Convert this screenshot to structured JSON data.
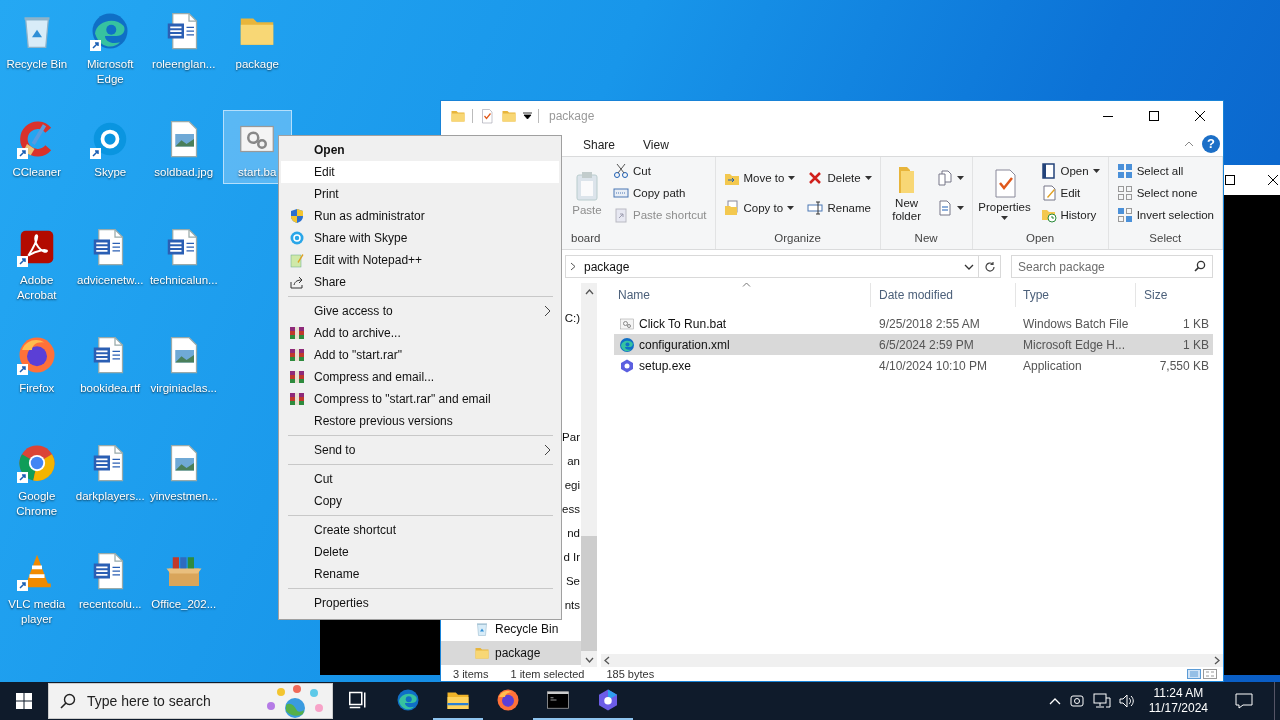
{
  "desktop_icons": [
    {
      "label": "Recycle Bin",
      "kind": "recycle",
      "shortcut": false,
      "selected": false
    },
    {
      "label": "CCleaner",
      "kind": "ccleaner",
      "shortcut": true,
      "selected": false
    },
    {
      "label": "Adobe Acrobat",
      "kind": "acrobat",
      "shortcut": true,
      "selected": false
    },
    {
      "label": "Firefox",
      "kind": "firefox",
      "shortcut": true,
      "selected": false
    },
    {
      "label": "Google Chrome",
      "kind": "chrome",
      "shortcut": true,
      "selected": false
    },
    {
      "label": "VLC media player",
      "kind": "vlc",
      "shortcut": true,
      "selected": false
    },
    {
      "label": "Microsoft Edge",
      "kind": "edge",
      "shortcut": true,
      "selected": false
    },
    {
      "label": "Skype",
      "kind": "skype",
      "shortcut": true,
      "selected": false
    },
    {
      "label": "advicenetw...",
      "kind": "word",
      "shortcut": false,
      "selected": false
    },
    {
      "label": "bookidea.rtf",
      "kind": "word",
      "shortcut": false,
      "selected": false
    },
    {
      "label": "darkplayers...",
      "kind": "word",
      "shortcut": false,
      "selected": false
    },
    {
      "label": "recentcolu...",
      "kind": "word",
      "shortcut": false,
      "selected": false
    },
    {
      "label": "roleenglan...",
      "kind": "word",
      "shortcut": false,
      "selected": false
    },
    {
      "label": "soldbad.jpg",
      "kind": "image",
      "shortcut": false,
      "selected": false
    },
    {
      "label": "technicalun...",
      "kind": "word",
      "shortcut": false,
      "selected": false
    },
    {
      "label": "virginiaclas...",
      "kind": "image",
      "shortcut": false,
      "selected": false
    },
    {
      "label": "yinvestmen...",
      "kind": "image",
      "shortcut": false,
      "selected": false
    },
    {
      "label": "Office_202...",
      "kind": "archive",
      "shortcut": false,
      "selected": false
    },
    {
      "label": "package",
      "kind": "folder",
      "shortcut": false,
      "selected": false
    },
    {
      "label": "start.ba",
      "kind": "bat",
      "shortcut": false,
      "selected": true
    }
  ],
  "explorer": {
    "title": "package",
    "ribbon_tabs": [
      {
        "label": "Share",
        "selected": false
      },
      {
        "label": "View",
        "selected": false
      }
    ],
    "help_label": "?",
    "ribbon_groups": [
      {
        "label": "board",
        "columns": [
          {
            "kind": "large",
            "buttons": [
              {
                "label": "Paste",
                "kind": "paste",
                "dropdown": false,
                "disabled": true
              }
            ]
          },
          {
            "kind": "small",
            "buttons": [
              {
                "label": "Cut",
                "kind": "cut",
                "dropdown": false,
                "disabled": false
              },
              {
                "label": "Copy path",
                "kind": "copypath",
                "dropdown": false,
                "disabled": false
              },
              {
                "label": "Paste shortcut",
                "kind": "pasteshortcut",
                "dropdown": false,
                "disabled": true
              }
            ]
          }
        ]
      },
      {
        "label": "Organize",
        "columns": [
          {
            "kind": "small",
            "buttons": [
              {
                "label": "Move to",
                "kind": "move",
                "dropdown": true,
                "disabled": false
              },
              {
                "label": "Copy to",
                "kind": "copy",
                "dropdown": true,
                "disabled": false
              }
            ]
          },
          {
            "kind": "small",
            "buttons": [
              {
                "label": "Delete",
                "kind": "delete",
                "dropdown": true,
                "disabled": false
              },
              {
                "label": "Rename",
                "kind": "rename",
                "dropdown": false,
                "disabled": false
              }
            ]
          }
        ]
      },
      {
        "label": "New",
        "columns": [
          {
            "kind": "large",
            "buttons": [
              {
                "label": "New folder",
                "kind": "newfolder",
                "dropdown": false,
                "disabled": false
              }
            ]
          },
          {
            "kind": "small",
            "buttons": [
              {
                "kind": "newitem",
                "dropdown": true,
                "disabled": false
              },
              {
                "kind": "easyaccess",
                "dropdown": true,
                "disabled": false
              }
            ]
          }
        ]
      },
      {
        "label": "Open",
        "columns": [
          {
            "kind": "large",
            "buttons": [
              {
                "label": "Properties",
                "kind": "properties",
                "dropdown": true,
                "disabled": false
              }
            ]
          },
          {
            "kind": "small",
            "buttons": [
              {
                "label": "Open",
                "kind": "open",
                "dropdown": true,
                "disabled": false
              },
              {
                "label": "Edit",
                "kind": "edit",
                "dropdown": false,
                "disabled": false
              },
              {
                "label": "History",
                "kind": "history",
                "dropdown": false,
                "disabled": false
              }
            ]
          }
        ]
      },
      {
        "label": "Select",
        "columns": [
          {
            "kind": "small",
            "buttons": [
              {
                "label": "Select all",
                "kind": "selectall",
                "dropdown": false,
                "disabled": false
              },
              {
                "label": "Select none",
                "kind": "selectnone",
                "dropdown": false,
                "disabled": false
              },
              {
                "label": "Invert selection",
                "kind": "invert",
                "dropdown": false,
                "disabled": false
              }
            ]
          }
        ]
      }
    ],
    "address": "package",
    "search_placeholder": "Search package",
    "nav_items": [
      {
        "label": "C:)",
        "kind": "fragment",
        "selected": false
      },
      {
        "label": "Par",
        "kind": "fragment",
        "selected": false
      },
      {
        "label": "an",
        "kind": "fragment",
        "selected": false
      },
      {
        "label": "egi",
        "kind": "fragment",
        "selected": false
      },
      {
        "label": "ess",
        "kind": "fragment",
        "selected": false
      },
      {
        "label": "nd",
        "kind": "fragment",
        "selected": false
      },
      {
        "label": "d Ir",
        "kind": "fragment",
        "selected": false
      },
      {
        "label": "Se",
        "kind": "fragment",
        "selected": false
      },
      {
        "label": "nts",
        "kind": "fragment",
        "selected": false
      },
      {
        "label": "Recycle Bin",
        "kind": "recycle",
        "selected": false
      },
      {
        "label": "package",
        "kind": "folder",
        "selected": true
      }
    ],
    "columns": [
      {
        "label": "Name",
        "sorted": true
      },
      {
        "label": "Date modified",
        "sorted": false
      },
      {
        "label": "Type",
        "sorted": false
      },
      {
        "label": "Size",
        "sorted": false
      }
    ],
    "rows": [
      {
        "kind": "bat",
        "name": "Click To Run.bat",
        "date": "9/25/2018 2:55 AM",
        "type": "Windows Batch File",
        "size": "1 KB",
        "selected": false
      },
      {
        "kind": "edge",
        "name": "configuration.xml",
        "date": "6/5/2024 2:59 PM",
        "type": "Microsoft Edge H...",
        "size": "1 KB",
        "selected": true
      },
      {
        "kind": "setup",
        "name": "setup.exe",
        "date": "4/10/2024 10:10 PM",
        "type": "Application",
        "size": "7,550 KB",
        "selected": false
      }
    ],
    "status": [
      "3 items",
      "1 item selected",
      "185 bytes"
    ]
  },
  "context_menu": {
    "items": [
      {
        "kind": "plain",
        "label": "Open",
        "bold": true,
        "selected": false,
        "submenu": false
      },
      {
        "kind": "plain",
        "label": "Edit",
        "bold": false,
        "selected": true,
        "submenu": false
      },
      {
        "kind": "plain",
        "label": "Print",
        "bold": false,
        "selected": false,
        "submenu": false
      },
      {
        "kind": "shield",
        "label": "Run as administrator",
        "bold": false,
        "selected": false,
        "submenu": false
      },
      {
        "kind": "skype",
        "label": "Share with Skype",
        "bold": false,
        "selected": false,
        "submenu": false
      },
      {
        "kind": "notepad",
        "label": "Edit with Notepad++",
        "bold": false,
        "selected": false,
        "submenu": false
      },
      {
        "kind": "share",
        "label": "Share",
        "bold": false,
        "selected": false,
        "submenu": false
      },
      {
        "kind": "separator"
      },
      {
        "kind": "plain",
        "label": "Give access to",
        "bold": false,
        "selected": false,
        "submenu": true
      },
      {
        "kind": "winrar",
        "label": "Add to archive...",
        "bold": false,
        "selected": false,
        "submenu": false
      },
      {
        "kind": "winrar",
        "label": "Add to \"start.rar\"",
        "bold": false,
        "selected": false,
        "submenu": false
      },
      {
        "kind": "winrar",
        "label": "Compress and email...",
        "bold": false,
        "selected": false,
        "submenu": false
      },
      {
        "kind": "winrar",
        "label": "Compress to \"start.rar\" and email",
        "bold": false,
        "selected": false,
        "submenu": false
      },
      {
        "kind": "plain",
        "label": "Restore previous versions",
        "bold": false,
        "selected": false,
        "submenu": false
      },
      {
        "kind": "separator"
      },
      {
        "kind": "plain",
        "label": "Send to",
        "bold": false,
        "selected": false,
        "submenu": true
      },
      {
        "kind": "separator"
      },
      {
        "kind": "plain",
        "label": "Cut",
        "bold": false,
        "selected": false,
        "submenu": false
      },
      {
        "kind": "plain",
        "label": "Copy",
        "bold": false,
        "selected": false,
        "submenu": false
      },
      {
        "kind": "separator"
      },
      {
        "kind": "plain",
        "label": "Create shortcut",
        "bold": false,
        "selected": false,
        "submenu": false
      },
      {
        "kind": "plain",
        "label": "Delete",
        "bold": false,
        "selected": false,
        "submenu": false
      },
      {
        "kind": "plain",
        "label": "Rename",
        "bold": false,
        "selected": false,
        "submenu": false
      },
      {
        "kind": "separator"
      },
      {
        "kind": "plain",
        "label": "Properties",
        "bold": false,
        "selected": false,
        "submenu": false
      }
    ]
  },
  "taskbar": {
    "search_placeholder": "Type here to search",
    "apps": [
      {
        "kind": "taskview",
        "running": false
      },
      {
        "kind": "edge",
        "running": false
      },
      {
        "kind": "explorer",
        "running": true
      },
      {
        "kind": "firefox",
        "running": false
      },
      {
        "kind": "cmd",
        "running": true
      },
      {
        "kind": "copilot",
        "running": true
      }
    ],
    "time": "11:24 AM",
    "date": "11/17/2024"
  }
}
